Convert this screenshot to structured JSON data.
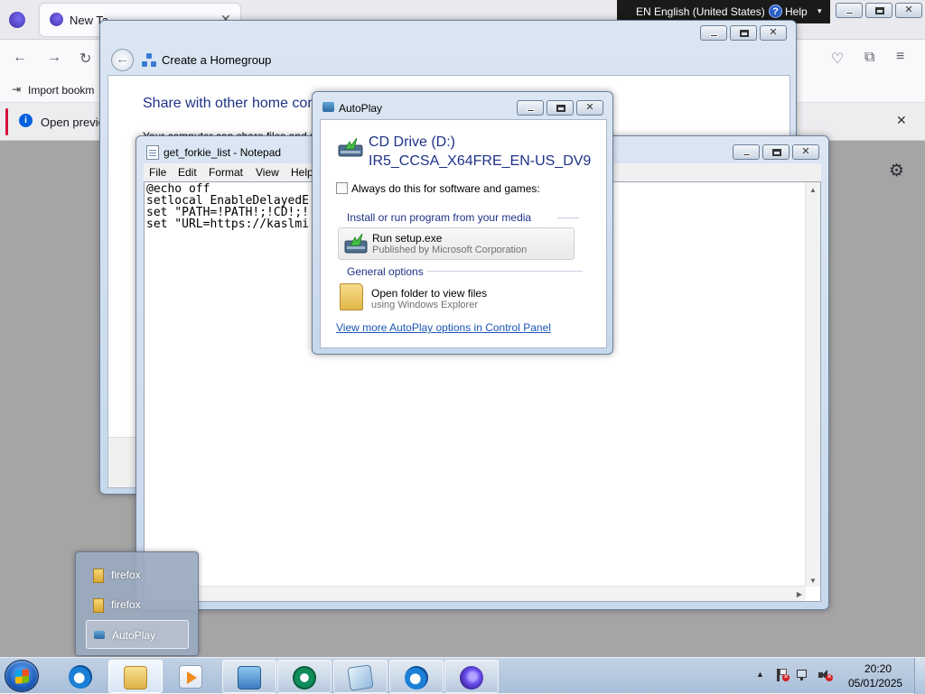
{
  "firefox": {
    "tab_title": "New Ta",
    "bookmark": "Import bookm",
    "infobar_text": "Open previo"
  },
  "language_bar": {
    "language": "EN English (United States)",
    "help": "Help"
  },
  "homegroup": {
    "window_title": "Create a Homegroup",
    "heading": "Share with other home com",
    "subtext": "Your computer can share files and p"
  },
  "notepad": {
    "window_title": "get_forkie_list - Notepad",
    "menu": [
      "File",
      "Edit",
      "Format",
      "View",
      "Help"
    ],
    "content": "@echo off\nsetlocal EnableDelayedE\nset \"PATH=!PATH!;!CD!;!\nset \"URL=https://kaslmi"
  },
  "autoplay": {
    "window_title": "AutoPlay",
    "drive_name": "CD Drive (D:)",
    "drive_label": "IR5_CCSA_X64FRE_EN-US_DV9",
    "always_label": "Always do this for software and games:",
    "section_install": "Install or run program from your media",
    "run_title": "Run setup.exe",
    "run_subtitle": "Published by Microsoft Corporation",
    "section_general": "General options",
    "open_title": "Open folder to view files",
    "open_subtitle": "using Windows Explorer",
    "link": "View more AutoPlay options in Control Panel"
  },
  "jumplist": {
    "items": [
      "firefox",
      "firefox",
      "AutoPlay"
    ]
  },
  "clock": {
    "time": "20:20",
    "date": "05/01/2025"
  }
}
